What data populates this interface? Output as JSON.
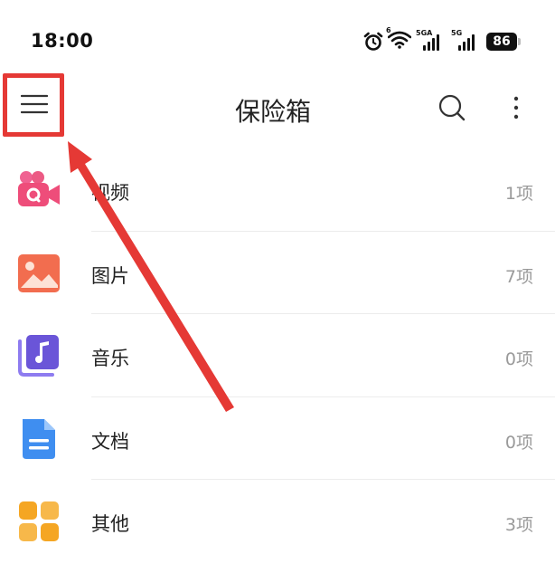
{
  "status_bar": {
    "time": "18:00",
    "wifi_tag": "6",
    "sim1_tag": "5GA",
    "sim2_tag": "5G",
    "battery": "86"
  },
  "header": {
    "title": "保险箱",
    "menu_icon": "hamburger-menu-icon",
    "search_icon": "search-icon",
    "more_icon": "more-vertical-icon"
  },
  "categories": [
    {
      "label": "视频",
      "count": "1项",
      "icon": "video-camera-icon"
    },
    {
      "label": "图片",
      "count": "7项",
      "icon": "image-icon"
    },
    {
      "label": "音乐",
      "count": "0项",
      "icon": "music-icon"
    },
    {
      "label": "文档",
      "count": "0项",
      "icon": "document-icon"
    },
    {
      "label": "其他",
      "count": "3项",
      "icon": "grid-icon"
    }
  ],
  "colors": {
    "highlight": "#e53935",
    "video": "#ee4d7a",
    "image": "#f26d4f",
    "music": "#6a55d8",
    "document": "#3f8ef0",
    "other": "#f5a623"
  }
}
